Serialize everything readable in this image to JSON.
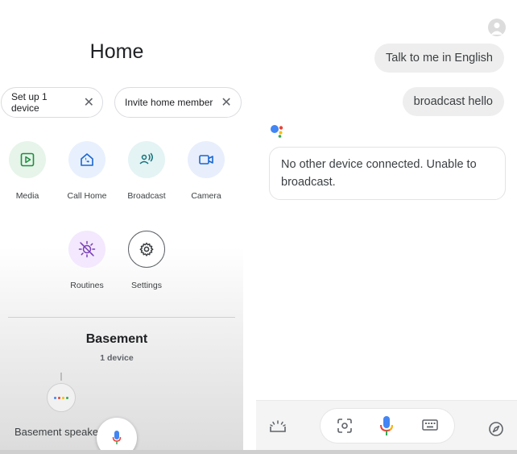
{
  "home": {
    "title": "Home",
    "chips": [
      {
        "label": "Set up 1 device"
      },
      {
        "label": "Invite home member"
      }
    ],
    "actions": [
      {
        "label": "Media",
        "icon": "play-icon"
      },
      {
        "label": "Call Home",
        "icon": "call-home-icon"
      },
      {
        "label": "Broadcast",
        "icon": "broadcast-icon"
      },
      {
        "label": "Camera",
        "icon": "camera-icon"
      },
      {
        "label": "Routines",
        "icon": "routines-icon"
      },
      {
        "label": "Settings",
        "icon": "gear-icon"
      }
    ],
    "room": {
      "name": "Basement",
      "count": "1 device",
      "device_name": "Basement speaker"
    }
  },
  "assistant": {
    "messages": [
      {
        "from": "user",
        "text": "Talk to me in English"
      },
      {
        "from": "user",
        "text": "broadcast hello"
      },
      {
        "from": "assistant",
        "text": "No other device connected. Unable to broadcast."
      }
    ]
  },
  "colors": {
    "google_blue": "#4285f4",
    "google_red": "#ea4335",
    "google_yellow": "#fbbc04",
    "google_green": "#34a853"
  }
}
